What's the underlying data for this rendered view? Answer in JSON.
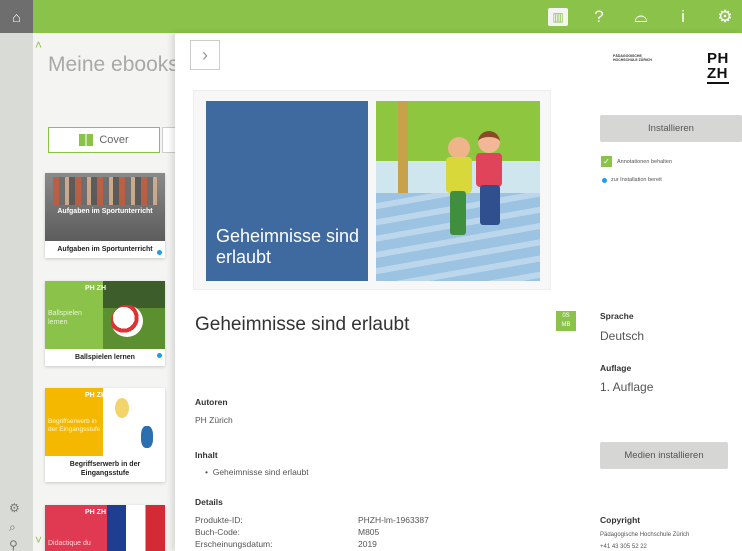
{
  "topbar": {
    "icons": [
      "home-icon",
      "library-icon",
      "help-icon",
      "glasses-icon",
      "info-icon",
      "settings-icon"
    ]
  },
  "library": {
    "title": "Meine ebooks",
    "cover_button": "Cover",
    "books": [
      {
        "thumb_title": "Aufgaben im Sportunterricht",
        "caption": "Aufgaben im Sportunterricht"
      },
      {
        "thumb_title": "Ballspielen lernen",
        "caption": "Ballspielen lernen"
      },
      {
        "thumb_title": "Begriffserwerb in der Eingangsstufe",
        "caption": "Begriffserwerb in der Eingangsstufe"
      },
      {
        "thumb_title": "Didactique du",
        "caption": ""
      }
    ],
    "logo_text": "PH ZH"
  },
  "detail": {
    "cover_title": "Geheimnisse sind erlaubt",
    "title": "Geheimnisse sind erlaubt",
    "size_badge": [
      "0S",
      "MB"
    ],
    "autoren_label": "Autoren",
    "autoren_value": "PH Zürich",
    "inhalt_label": "Inhalt",
    "inhalt_items": [
      "Geheimnisse sind erlaubt"
    ],
    "details_label": "Details",
    "details": [
      {
        "label": "Produkte-ID:",
        "value": "PHZH-lm-1963387"
      },
      {
        "label": "Buch-Code:",
        "value": "M805"
      },
      {
        "label": "Erscheinungsdatum:",
        "value": "2019"
      }
    ]
  },
  "right": {
    "logo_small": "PÄDAGOGISCHE HOCHSCHULE ZÜRICH",
    "logo_ph": "PH",
    "logo_zh": "ZH",
    "install_button": "Installieren",
    "annotations_label": "Annotationen behalten",
    "status_label": "zur Installation bereit",
    "sprache_label": "Sprache",
    "sprache_value": "Deutsch",
    "auflage_label": "Auflage",
    "auflage_value": "1. Auflage",
    "media_button": "Medien installieren",
    "copyright_label": "Copyright",
    "copyright_value": "Pädagogische Hochschule Zürich",
    "phone": "+41 43 305 52 22"
  },
  "colors": {
    "accent": "#8bc34a",
    "cover_blue": "#3f6aa0",
    "status_dot": "#1e9bf0"
  }
}
